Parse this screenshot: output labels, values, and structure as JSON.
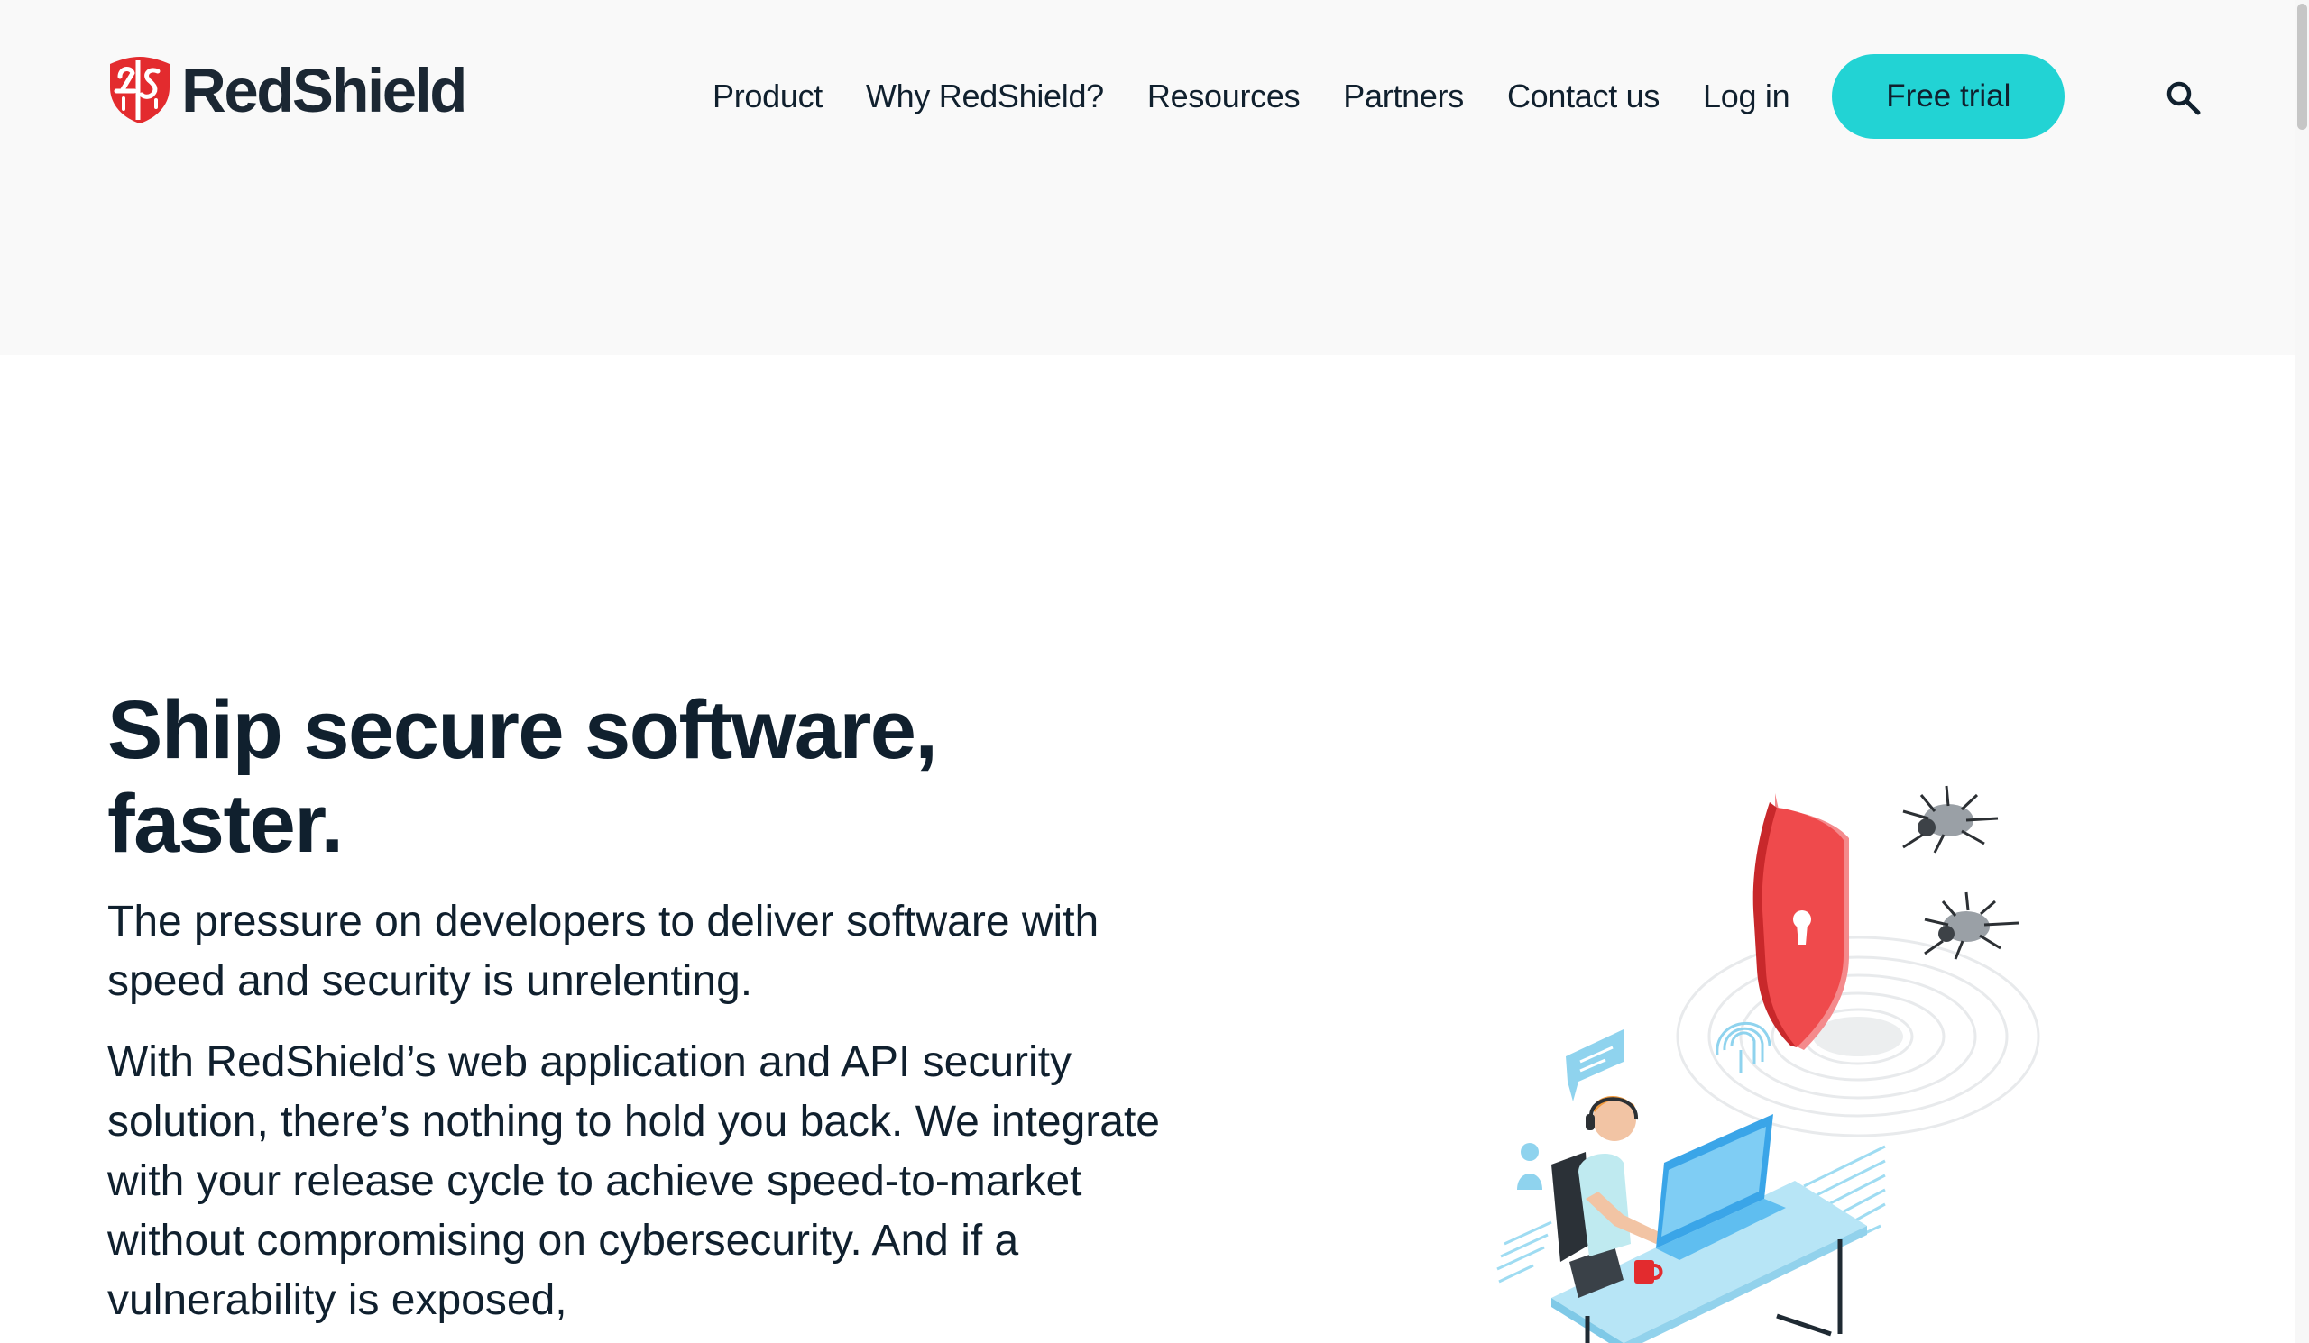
{
  "brand": {
    "name": "RedShield",
    "colors": {
      "logo_red": "#e32b2e",
      "accent_teal": "#22d3d4",
      "text_dark": "#10202e",
      "header_bg": "#f9f9f9"
    }
  },
  "nav": {
    "items": [
      {
        "label": "Product"
      },
      {
        "label": "Why RedShield?"
      },
      {
        "label": "Resources"
      },
      {
        "label": "Partners"
      },
      {
        "label": "Contact us"
      },
      {
        "label": "Log in"
      }
    ],
    "cta_label": "Free trial",
    "search_icon": "magnifier-icon"
  },
  "hero": {
    "title": "Ship secure software, faster.",
    "paragraph_1": "The pressure on developers to deliver software with speed and security is unrelenting.",
    "paragraph_2": "With RedShield’s web application and API security solution, there’s nothing to hold you back. We integrate with your release cycle to achieve speed-to-market without compromising on cybersecurity. And if a vulnerability is exposed,",
    "illustration_icon": "developer-shield-bugs-illustration"
  }
}
